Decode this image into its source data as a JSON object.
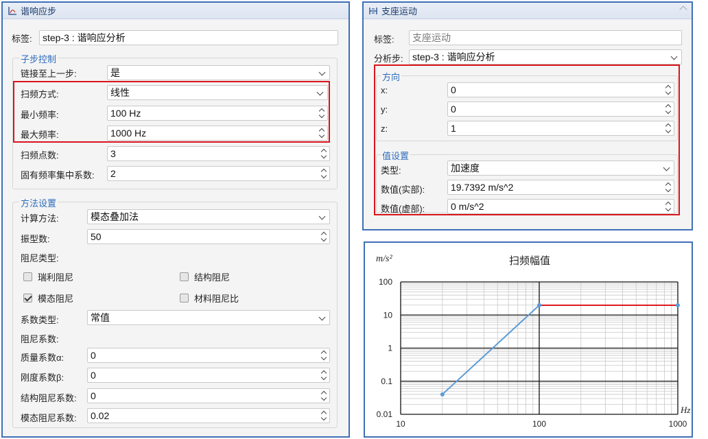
{
  "left_panel": {
    "title": "谐响应步",
    "label_text": "标签:",
    "label_value": "step-3 : 谐响应分析",
    "substep": {
      "group_title": "子步控制",
      "link_label": "链接至上一步:",
      "link_value": "是",
      "sweep_label": "扫频方式:",
      "sweep_value": "线性",
      "fmin_label": "最小频率:",
      "fmin_value": "100 Hz",
      "fmax_label": "最大频率:",
      "fmax_value": "1000 Hz",
      "points_label": "扫频点数:",
      "points_value": "3",
      "bias_label": "固有频率集中系数:",
      "bias_value": "2"
    },
    "method": {
      "group_title": "方法设置",
      "calc_label": "计算方法:",
      "calc_value": "模态叠加法",
      "modes_label": "振型数:",
      "modes_value": "50",
      "damp_type_label": "阻尼类型:",
      "rayleigh": "瑞利阻尼",
      "structural": "结构阻尼",
      "modal": "模态阻尼",
      "material": "材料阻尼比",
      "coef_type_label": "系数类型:",
      "coef_type_value": "常值",
      "damp_coef_label": "阻尼系数:",
      "alpha_label": "质量系数α:",
      "alpha_value": "0",
      "beta_label": "刚度系数β:",
      "beta_value": "0",
      "struct_coef_label": "结构阻尼系数:",
      "struct_coef_value": "0",
      "modal_coef_label": "模态阻尼系数:",
      "modal_coef_value": "0.02"
    }
  },
  "right_panel": {
    "title": "支座运动",
    "label_text": "标签:",
    "label_value": "支座运动",
    "step_label": "分析步:",
    "step_value": "step-3 : 谐响应分析",
    "direction": {
      "group_title": "方向",
      "x_label": "x:",
      "x_value": "0",
      "y_label": "y:",
      "y_value": "0",
      "z_label": "z:",
      "z_value": "1"
    },
    "value_settings": {
      "group_title": "值设置",
      "type_label": "类型:",
      "type_value": "加速度",
      "real_label": "数值(实部):",
      "real_value": "19.7392 m/s^2",
      "imag_label": "数值(虚部):",
      "imag_value": "0 m/s^2"
    }
  },
  "chart_data": {
    "type": "line",
    "title": "扫频幅值",
    "ylabel": "m/s²",
    "xlabel": "Hz",
    "xscale": "log",
    "yscale": "log",
    "xlim": [
      10,
      1000
    ],
    "ylim": [
      0.01,
      100
    ],
    "xticks": [
      "10",
      "100",
      "1000"
    ],
    "yticks": [
      "100",
      "10",
      "1",
      "0.1",
      "0.01"
    ],
    "grid": true,
    "series": [
      {
        "color": "#5b9bd5",
        "x": [
          20,
          100
        ],
        "y": [
          0.04,
          19.7392
        ]
      },
      {
        "color": "#e0191f",
        "x": [
          100,
          1000
        ],
        "y": [
          19.7392,
          19.7392
        ]
      }
    ],
    "colors": {
      "accent": "#2f6dbb",
      "highlight": "#d9141b",
      "border": "#3e6fb6"
    }
  }
}
